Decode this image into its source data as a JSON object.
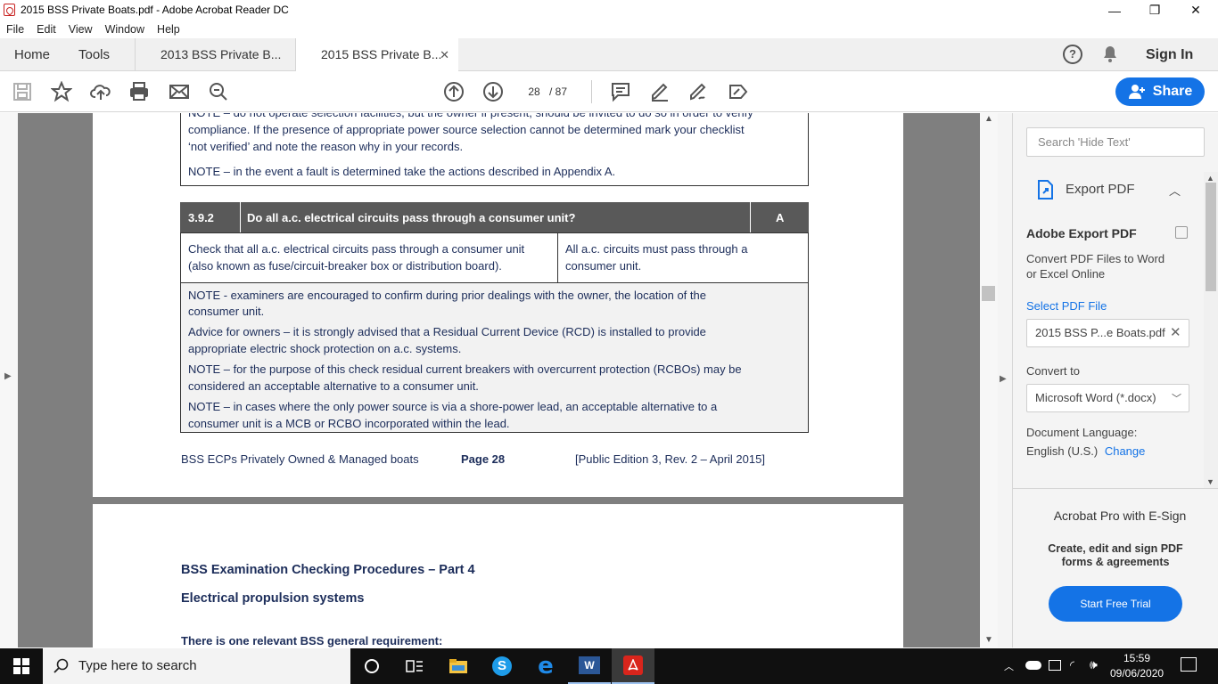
{
  "window": {
    "title": "2015 BSS Private Boats.pdf - Adobe Acrobat Reader DC",
    "minimize": "—",
    "restore": "❐",
    "close": "✕"
  },
  "menu": [
    "File",
    "Edit",
    "View",
    "Window",
    "Help"
  ],
  "tabs": {
    "home": "Home",
    "tools": "Tools",
    "doc1": "2013 BSS Private B...",
    "doc2": "2015 BSS Private B...",
    "close": "✕",
    "sign_in": "Sign In"
  },
  "toolbar": {
    "page_current": "28",
    "page_total": "/ 87",
    "share": "Share"
  },
  "document": {
    "page1": {
      "note_top_1": "NOTE – do not operate selection facilities, but the owner if present, should be invited to do so in order to verify",
      "note_top_2": "compliance.  If the presence of appropriate power source selection cannot be determined mark your checklist",
      "note_top_3": "‘not verified’ and note the reason why in your records.",
      "note_fault": "NOTE –  in the event a fault is determined take the actions described in Appendix A.",
      "check_num": "3.9.2",
      "check_question": "Do all a.c. electrical circuits pass through a consumer unit?",
      "check_grade": "A",
      "check_left_1": "Check that all a.c. electrical circuits pass through a consumer unit",
      "check_left_2": "(also known as fuse/circuit-breaker box or distribution board).",
      "check_right_1": "All a.c. circuits must pass through a",
      "check_right_2": "consumer unit.",
      "note1_1": "NOTE - examiners are encouraged to confirm during prior dealings with the owner, the location of the",
      "note1_2": "consumer unit.",
      "note2_1": "Advice for owners – it is strongly advised that a Residual Current Device (RCD) is installed to provide",
      "note2_2": "appropriate electric shock protection on a.c. systems.",
      "note3_1": "NOTE – for the purpose of this check residual current breakers with overcurrent protection (RCBOs) may be",
      "note3_2": "considered an acceptable alternative to a consumer unit.",
      "note4_1": "NOTE – in cases where the only power source is via a shore-power lead, an acceptable alternative to a",
      "note4_2": "consumer unit is a MCB or RCBO incorporated within the lead.",
      "footer_left": "BSS ECPs Privately Owned & Managed boats",
      "footer_mid": "Page 28",
      "footer_right": "[Public Edition 3, Rev. 2 – April 2015]"
    },
    "page2": {
      "heading1": "BSS Examination Checking Procedures – Part 4",
      "heading2": "Electrical propulsion systems",
      "line1": "There is one relevant BSS general requirement:"
    }
  },
  "right_panel": {
    "search_placeholder": "Search 'Hide Text'",
    "export_title": "Export PDF",
    "adobe_export": "Adobe Export PDF",
    "convert_desc_1": "Convert PDF Files to Word",
    "convert_desc_2": "or Excel Online",
    "select_file": "Select PDF File",
    "file_name": "2015 BSS P...e Boats.pdf",
    "convert_to": "Convert to",
    "format": "Microsoft Word (*.docx)",
    "doc_lang": "Document Language:",
    "lang": "English (U.S.)",
    "change": "Change",
    "promo_title": "Acrobat Pro with E-Sign",
    "promo_desc_1": "Create, edit and sign PDF",
    "promo_desc_2": "forms & agreements",
    "trial": "Start Free Trial"
  },
  "taskbar": {
    "search": "Type here to search",
    "time": "15:59",
    "date": "09/06/2020"
  },
  "colors": {
    "accent": "#1473e6",
    "doc_text": "#1c2d5a",
    "table_header": "#595959"
  }
}
